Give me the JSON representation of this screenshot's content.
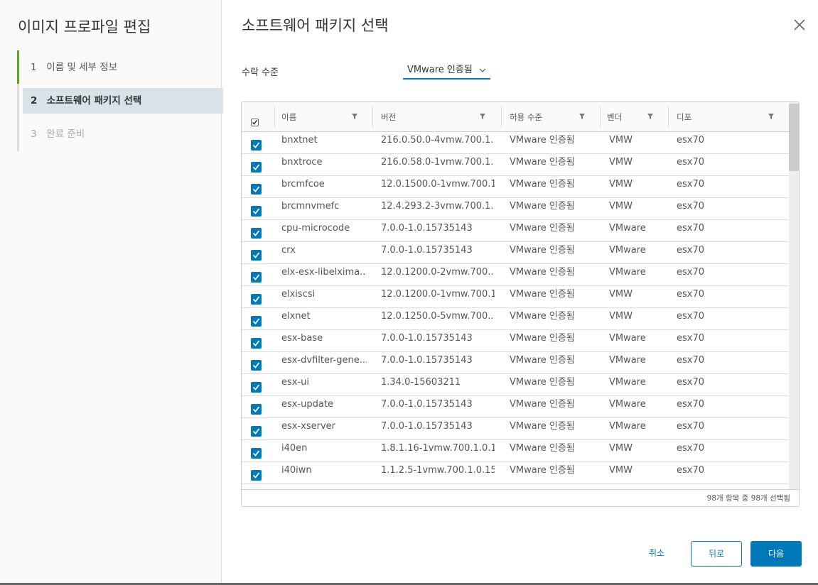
{
  "left_panel": {
    "title": "이미지 프로파일 편집",
    "steps": [
      {
        "num": "1",
        "label": "이름 및 세부 정보"
      },
      {
        "num": "2",
        "label": "소프트웨어 패키지 선택"
      },
      {
        "num": "3",
        "label": "완료 준비"
      }
    ]
  },
  "main": {
    "title": "소프트웨어 패키지 선택",
    "acceptance_label": "수락 수준",
    "acceptance_value": "VMware 인증됨"
  },
  "grid": {
    "columns": [
      "이름",
      "버전",
      "허용 수준",
      "벤더",
      "디포"
    ],
    "rows": [
      {
        "name": "bnxtnet",
        "version": "216.0.50.0-4vmw.700.1...",
        "level": "VMware 인증됨",
        "vendor": "VMW",
        "depot": "esx70"
      },
      {
        "name": "bnxtroce",
        "version": "216.0.58.0-1vmw.700.1....",
        "level": "VMware 인증됨",
        "vendor": "VMW",
        "depot": "esx70"
      },
      {
        "name": "brcmfcoe",
        "version": "12.0.1500.0-1vmw.700.1...",
        "level": "VMware 인증됨",
        "vendor": "VMW",
        "depot": "esx70"
      },
      {
        "name": "brcmnvmefc",
        "version": "12.4.293.2-3vmw.700.1....",
        "level": "VMware 인증됨",
        "vendor": "VMW",
        "depot": "esx70"
      },
      {
        "name": "cpu-microcode",
        "version": "7.0.0-1.0.15735143",
        "level": "VMware 인증됨",
        "vendor": "VMware",
        "depot": "esx70"
      },
      {
        "name": "crx",
        "version": "7.0.0-1.0.15735143",
        "level": "VMware 인증됨",
        "vendor": "VMware",
        "depot": "esx70"
      },
      {
        "name": "elx-esx-libelxima....",
        "version": "12.0.1200.0-2vmw.700....",
        "level": "VMware 인증됨",
        "vendor": "VMware",
        "depot": "esx70"
      },
      {
        "name": "elxiscsi",
        "version": "12.0.1200.0-1vmw.700.1...",
        "level": "VMware 인증됨",
        "vendor": "VMW",
        "depot": "esx70"
      },
      {
        "name": "elxnet",
        "version": "12.0.1250.0-5vmw.700....",
        "level": "VMware 인증됨",
        "vendor": "VMW",
        "depot": "esx70"
      },
      {
        "name": "esx-base",
        "version": "7.0.0-1.0.15735143",
        "level": "VMware 인증됨",
        "vendor": "VMware",
        "depot": "esx70"
      },
      {
        "name": "esx-dvfilter-gene...",
        "version": "7.0.0-1.0.15735143",
        "level": "VMware 인증됨",
        "vendor": "VMware",
        "depot": "esx70"
      },
      {
        "name": "esx-ui",
        "version": "1.34.0-15603211",
        "level": "VMware 인증됨",
        "vendor": "VMware",
        "depot": "esx70"
      },
      {
        "name": "esx-update",
        "version": "7.0.0-1.0.15735143",
        "level": "VMware 인증됨",
        "vendor": "VMware",
        "depot": "esx70"
      },
      {
        "name": "esx-xserver",
        "version": "7.0.0-1.0.15735143",
        "level": "VMware 인증됨",
        "vendor": "VMware",
        "depot": "esx70"
      },
      {
        "name": "i40en",
        "version": "1.8.1.16-1vmw.700.1.0.15...",
        "level": "VMware 인증됨",
        "vendor": "VMW",
        "depot": "esx70"
      },
      {
        "name": "i40iwn",
        "version": "1.1.2.5-1vmw.700.1.0.157...",
        "level": "VMware 인증됨",
        "vendor": "VMW",
        "depot": "esx70"
      }
    ],
    "footer": "98개 항목 중 98개 선택됨"
  },
  "buttons": {
    "cancel": "취소",
    "back": "뒤로",
    "next": "다음"
  },
  "colors": {
    "accent": "#0079b8",
    "step_done": "#62a420",
    "step_active_bg": "#d8e3e9"
  },
  "icons": [
    "close-icon",
    "filter-icon",
    "checkbox-checked-icon",
    "chevron-down-icon"
  ]
}
